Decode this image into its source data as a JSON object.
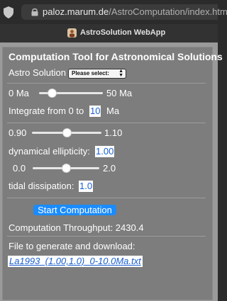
{
  "browser": {
    "url_host": "paloz.marum.de",
    "url_path": "/AstroComputation/index.html",
    "tab_title": "AstroSolution WebApp"
  },
  "app": {
    "title": "Computation Tool for Astronomical Solutions",
    "astro_solution_label": "Astro Solution",
    "astro_solution_select": "Please select:",
    "age_min_label": "0 Ma",
    "age_max_label": "50 Ma",
    "age_slider_value": 0.2,
    "integrate_prefix": "Integrate from 0 to",
    "integrate_value": "10",
    "integrate_unit": "Ma",
    "ellipticity_min_label": "0.90",
    "ellipticity_max_label": "1.10",
    "ellipticity_slider_value": 0.5,
    "ellipticity_label": "dynamical ellipticity:",
    "ellipticity_value": "1.00",
    "tidal_min_label": "0.0",
    "tidal_max_label": "2.0",
    "tidal_slider_value": 0.5,
    "tidal_label": "tidal dissipation:",
    "tidal_value": "1.0",
    "start_button": "Start Computation",
    "throughput_label": "Computation Throughput: 2430.4",
    "download_label": "File to generate and download:",
    "download_file": "La1993_(1.00,1.0)_0-10.0Ma.txt"
  },
  "colors": {
    "accent": "#1a8cff",
    "panel": "#7d7d7d",
    "page_background": "#9a9a9a"
  }
}
